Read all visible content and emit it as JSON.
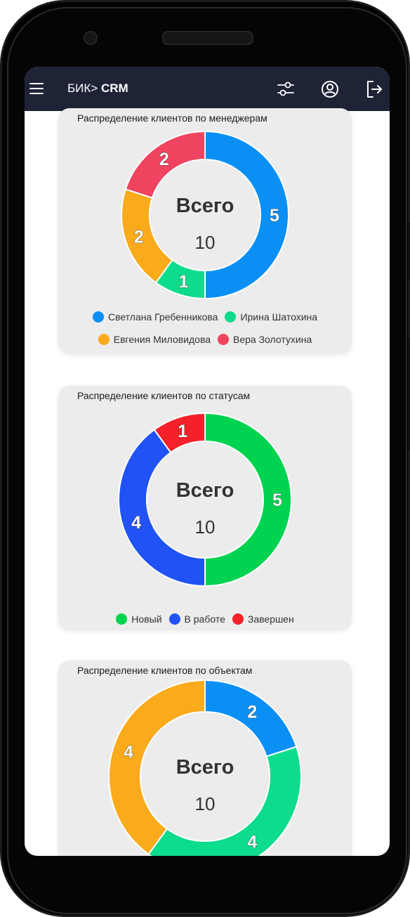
{
  "app": {
    "brand_prefix": "БИК>",
    "brand_name": "CRM",
    "icons": {
      "menu": "hamburger-menu-icon",
      "filters": "sliders-icon",
      "profile": "user-circle-icon",
      "logout": "logout-icon"
    }
  },
  "charts": [
    {
      "title": "Распределение клиентов по менеджерам",
      "center_label": "Всего",
      "center_value": "10",
      "legend_rows": [
        [
          0,
          1
        ],
        [
          2,
          3
        ]
      ]
    },
    {
      "title": "Распределение клиентов по статусам",
      "center_label": "Всего",
      "center_value": "10",
      "legend_rows": [
        [
          0,
          1,
          2
        ]
      ]
    },
    {
      "title": "Распределение клиентов по объектам",
      "center_label": "Всего",
      "center_value": "10",
      "legend_rows": []
    }
  ],
  "chart_data": [
    {
      "type": "pie",
      "title": "Распределение клиентов по менеджерам",
      "categories": [
        "Светлана Гребенникова",
        "Ирина Шатохина",
        "Евгения Миловидова",
        "Вера Золотухина"
      ],
      "values": [
        5,
        1,
        2,
        2
      ],
      "colors": [
        "#0a8ff5",
        "#0ddc8c",
        "#f9ab1c",
        "#f0435f"
      ],
      "total": 10,
      "legend": "bottom"
    },
    {
      "type": "pie",
      "title": "Распределение клиентов по статусам",
      "categories": [
        "Новый",
        "В работе",
        "Завершен"
      ],
      "values": [
        5,
        4,
        1
      ],
      "colors": [
        "#00d34f",
        "#2052f5",
        "#f5212a"
      ],
      "total": 10,
      "legend": "bottom"
    },
    {
      "type": "pie",
      "title": "Распределение клиентов по объектам",
      "categories": [],
      "values": [
        2,
        4,
        4
      ],
      "colors": [
        "#0a8ff5",
        "#0ddc8c",
        "#f9ab1c"
      ],
      "total": 10,
      "legend": "bottom"
    }
  ]
}
